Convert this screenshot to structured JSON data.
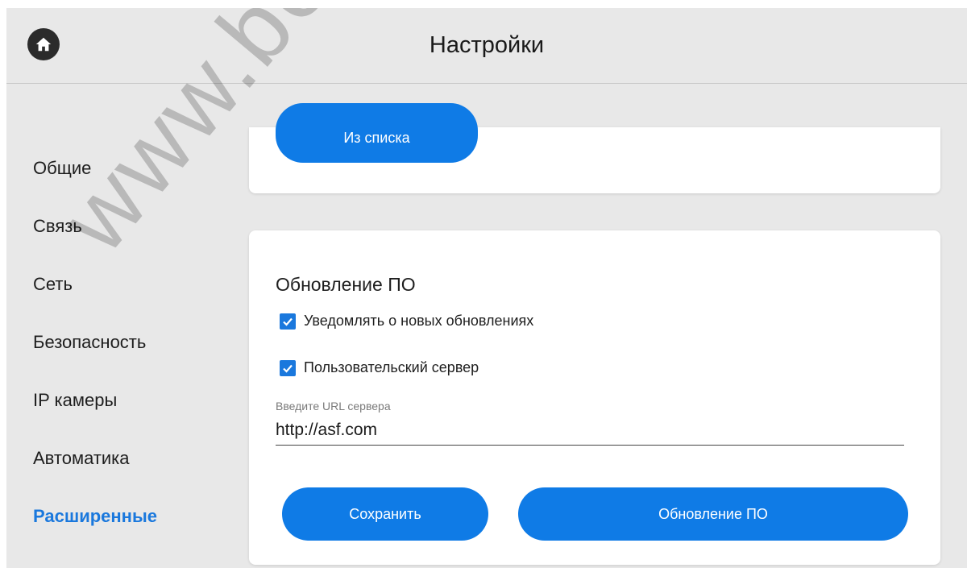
{
  "header": {
    "title": "Настройки",
    "home_icon": "home-icon"
  },
  "sidebar": {
    "items": [
      {
        "label": "Общие",
        "active": false
      },
      {
        "label": "Связь",
        "active": false
      },
      {
        "label": "Сеть",
        "active": false
      },
      {
        "label": "Безопасность",
        "active": false
      },
      {
        "label": "IP камеры",
        "active": false
      },
      {
        "label": "Автоматика",
        "active": false
      },
      {
        "label": "Расширенные",
        "active": true
      }
    ]
  },
  "top_card": {
    "list_button_label": "Из списка"
  },
  "update_section": {
    "title": "Обновление ПО",
    "notify_label": "Уведомлять о новых обновлениях",
    "notify_checked": true,
    "custom_server_label": "Пользовательский сервер",
    "custom_server_checked": true,
    "url_label": "Введите URL сервера",
    "url_value": "http://asf.com",
    "save_label": "Сохранить",
    "update_label": "Обновление ПО"
  },
  "watermark": "www.bezpe",
  "colors": {
    "accent": "#0f7be6",
    "active_nav": "#1a78dd",
    "background": "#e8e8e8",
    "card": "#ffffff"
  }
}
